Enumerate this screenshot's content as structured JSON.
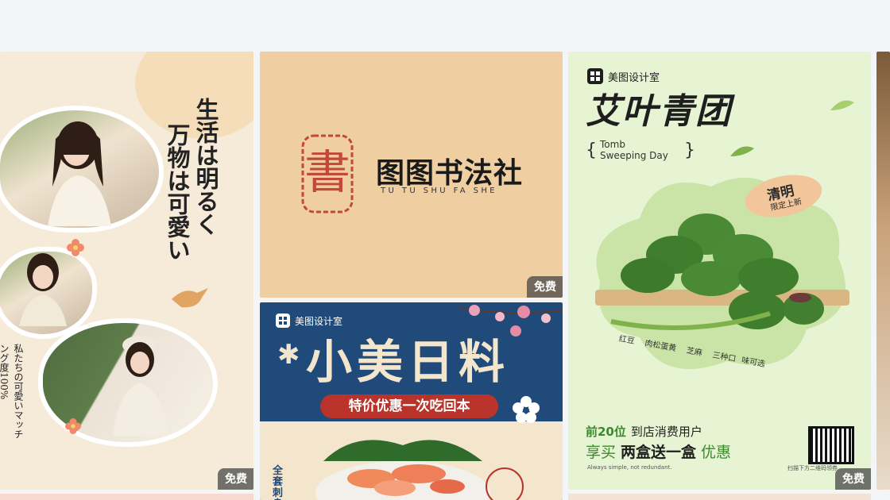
{
  "badge_label": "免费",
  "card1": {
    "title_col1": "生活は明るく",
    "title_col2": "万物は可愛い",
    "sub_col1": "私たちの可愛いマッチ",
    "sub_col2": "ング度100%"
  },
  "card2": {
    "seal_char": "書",
    "title": "图图书法社",
    "subtitle": "TU TU SHU FA SHE"
  },
  "card3": {
    "brand": "美图设计室",
    "title": "小美日料",
    "ribbon": "特价优惠一次吃回本",
    "side_text": "全套刺身"
  },
  "card4": {
    "brand": "美图设计室",
    "title": "艾叶青团",
    "english_line1": "Tomb",
    "english_line2": "Sweeping Day",
    "tag_main": "清明",
    "tag_sub": "限定上新",
    "flavors": [
      "红豆",
      "肉松蛋黄",
      "芝麻",
      "三种口",
      "味可选"
    ],
    "promo_line1_strong": "前20位",
    "promo_line1_rest": "到店消费用户",
    "promo_line2_a": "享买",
    "promo_line2_strong": "两盒送一盒",
    "promo_line2_b": "优惠",
    "tiny": "Always simple, not redundant.",
    "qr_caption": "扫描下方二维码领券"
  },
  "colors": {
    "green_accent": "#3a8a2a",
    "navy": "#1f4a7a",
    "red": "#b9332a",
    "beige": "#efcfa2"
  }
}
